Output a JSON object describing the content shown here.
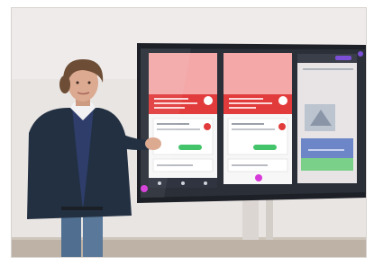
{
  "scene": {
    "kind": "photograph",
    "subject": "person-presenting-large-touchscreen",
    "colors": {
      "wall": "#e9e5e3",
      "floor": "#bdb2a5",
      "screen_bezel": "#1d2027",
      "app_red": "#e23b3b",
      "app_pink": "#f4a8a8",
      "app_green": "#43c36a",
      "app_magenta": "#d63ad8",
      "jacket": "#223042",
      "jeans": "#4f6e90",
      "skin": "#dca991",
      "hair": "#6d4d35",
      "blue_panel": "#6d86c7"
    }
  }
}
